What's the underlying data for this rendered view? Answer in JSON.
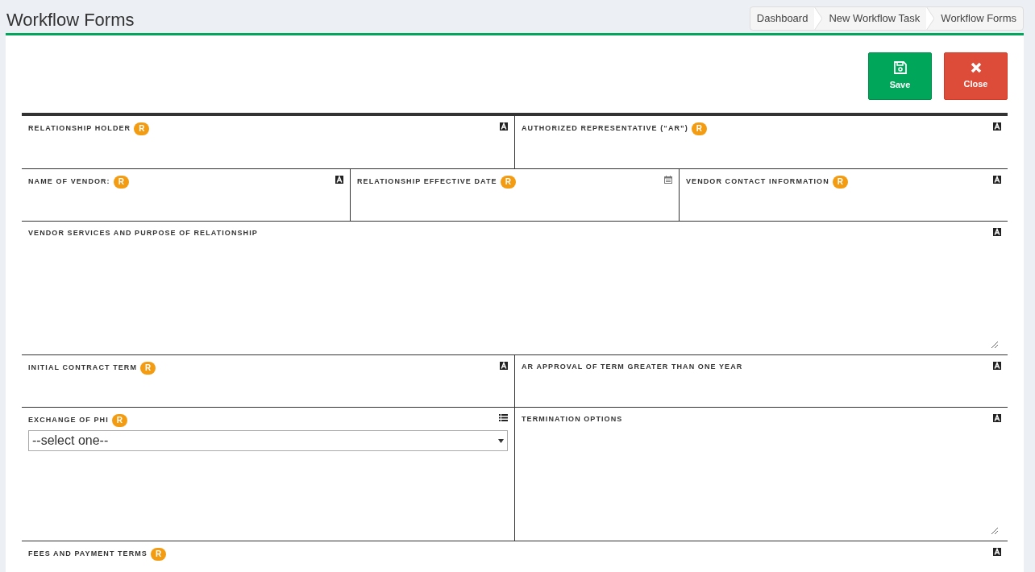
{
  "page_title": "Workflow Forms",
  "breadcrumb": [
    {
      "label": "Dashboard"
    },
    {
      "label": "New Workflow Task"
    },
    {
      "label": "Workflow Forms"
    }
  ],
  "buttons": [
    {
      "kind": "save",
      "label": "Save"
    },
    {
      "kind": "close",
      "label": "Close"
    }
  ],
  "form_rows": [
    {
      "kind": "short",
      "fields": [
        {
          "label": "RELATIONSHIP HOLDER",
          "badge": "R",
          "kind": "text"
        },
        {
          "label": "AUTHORIZED REPRESENTATIVE (“AR”)",
          "badge": "R",
          "kind": "text"
        }
      ]
    },
    {
      "kind": "short",
      "fields": [
        {
          "label": "NAME OF VENDOR:",
          "badge": "R",
          "kind": "text"
        },
        {
          "label": "RELATIONSHIP EFFECTIVE DATE",
          "badge": "R",
          "kind": "date"
        },
        {
          "label": "VENDOR CONTACT INFORMATION",
          "badge": "R",
          "kind": "text"
        }
      ]
    },
    {
      "kind": "tall",
      "fields": [
        {
          "label": "VENDOR SERVICES AND PURPOSE OF RELATIONSHIP",
          "kind": "textarea"
        }
      ]
    },
    {
      "kind": "short",
      "fields": [
        {
          "label": "INITIAL CONTRACT TERM",
          "badge": "R",
          "kind": "text"
        },
        {
          "label": "AR APPROVAL OF TERM GREATER THAN ONE YEAR",
          "kind": "text"
        }
      ]
    },
    {
      "kind": "tall",
      "fields": [
        {
          "label": "EXCHANGE OF PHI",
          "badge": "R",
          "kind": "select",
          "value": "--select one--"
        },
        {
          "label": "TERMINATION OPTIONS",
          "kind": "textarea"
        }
      ]
    },
    {
      "kind": "cut",
      "fields": [
        {
          "label": "FEES AND PAYMENT TERMS",
          "badge": "R",
          "kind": "text"
        }
      ]
    }
  ]
}
